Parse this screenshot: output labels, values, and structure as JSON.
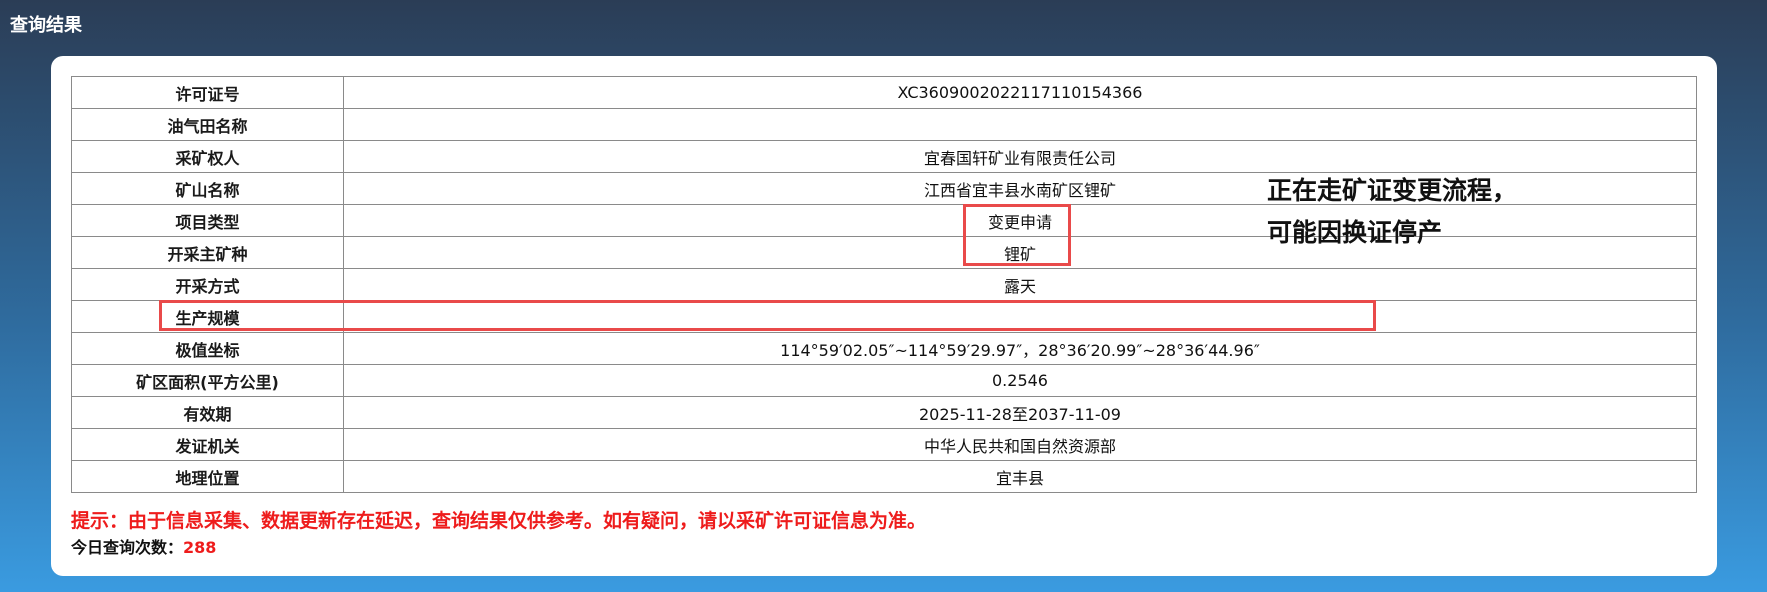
{
  "header": {
    "title": "查询结果"
  },
  "table": {
    "rows": [
      {
        "label": "许可证号",
        "value": "XC3609002022117110154366"
      },
      {
        "label": "油气田名称",
        "value": ""
      },
      {
        "label": "采矿权人",
        "value": "宜春国轩矿业有限责任公司"
      },
      {
        "label": "矿山名称",
        "value": "江西省宜丰县水南矿区锂矿"
      },
      {
        "label": "项目类型",
        "value": "变更申请"
      },
      {
        "label": "开采主矿种",
        "value": "锂矿"
      },
      {
        "label": "开采方式",
        "value": "露天"
      },
      {
        "label": "生产规模",
        "value": ""
      },
      {
        "label": "极值坐标",
        "value": "114°59′02.05″~114°59′29.97″，28°36′20.99″~28°36′44.96″"
      },
      {
        "label": "矿区面积(平方公里)",
        "value": "0.2546"
      },
      {
        "label": "有效期",
        "value": "2025-11-28至2037-11-09"
      },
      {
        "label": "发证机关",
        "value": "中华人民共和国自然资源部"
      },
      {
        "label": "地理位置",
        "value": "宜丰县"
      }
    ]
  },
  "annotation": {
    "line1": "正在走矿证变更流程，",
    "line2": "可能因换证停产"
  },
  "footer": {
    "notice": "提示：由于信息采集、数据更新存在延迟，查询结果仅供参考。如有疑问，请以采矿许可证信息为准。",
    "count_label": "今日查询次数：",
    "count_value": "288"
  },
  "colors": {
    "background_top": "#2b3d56",
    "background_bottom": "#3a9be0",
    "highlight_red": "#e94a4a",
    "notice_red": "#ee1c1c"
  }
}
